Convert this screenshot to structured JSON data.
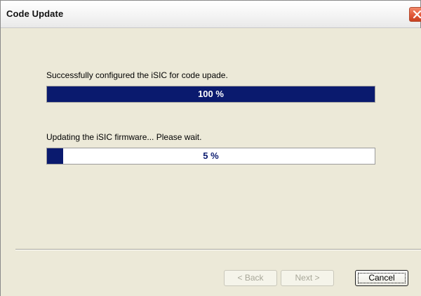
{
  "window": {
    "title": "Code Update"
  },
  "status": {
    "config_message": "Successfully configured the iSIC for code upade.",
    "config_progress_percent": 100,
    "config_progress_label": "100 %",
    "firmware_message": "Updating the iSIC firmware...  Please wait.",
    "firmware_progress_percent": 5,
    "firmware_progress_label": "5 %"
  },
  "buttons": {
    "back_label": "< Back",
    "back_enabled": false,
    "next_label": "Next >",
    "next_enabled": false,
    "cancel_label": "Cancel",
    "cancel_enabled": true
  },
  "colors": {
    "progress_fill": "#0a1a6e",
    "close_button": "#e2593a"
  },
  "icons": {
    "close": "close-icon"
  }
}
